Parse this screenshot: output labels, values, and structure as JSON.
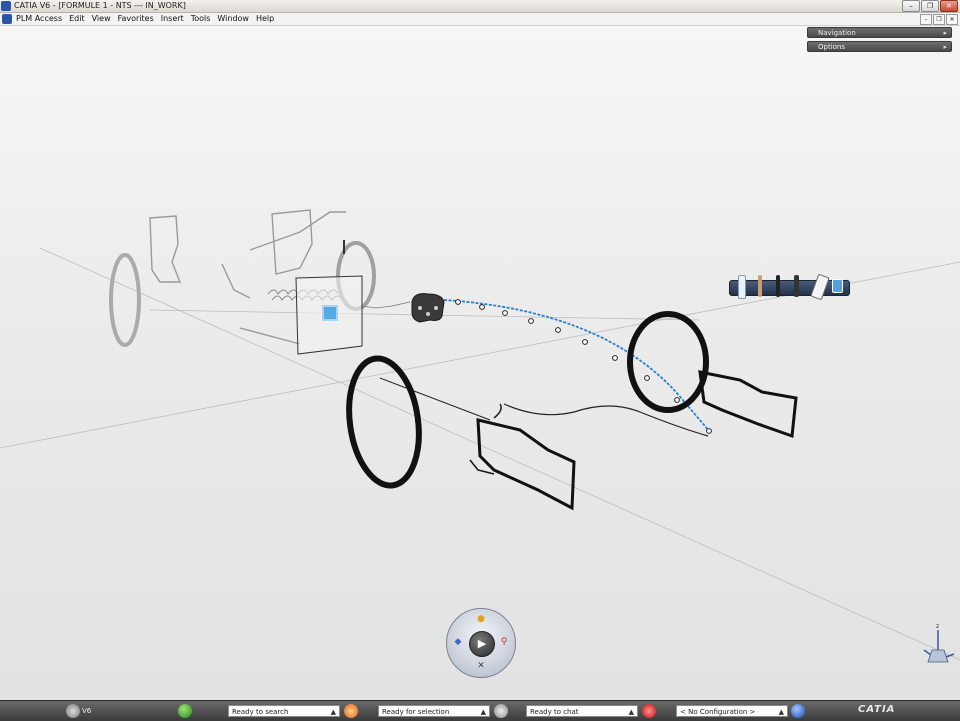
{
  "window": {
    "title": "CATIA V6 - [FORMULE 1 - NTS --- IN_WORK]"
  },
  "menubar": {
    "items": [
      {
        "label": "PLM Access"
      },
      {
        "label": "Edit"
      },
      {
        "label": "View"
      },
      {
        "label": "Favorites"
      },
      {
        "label": "Insert"
      },
      {
        "label": "Tools"
      },
      {
        "label": "Window"
      },
      {
        "label": "Help"
      }
    ]
  },
  "panels": {
    "navigation_label": "Navigation",
    "options_label": "Options"
  },
  "toolbar3d": {
    "tools": [
      "marker-tool-icon",
      "pencil-tool-icon",
      "pen-tool-icon",
      "brush-tool-icon",
      "eraser-tool-icon",
      "image-tool-icon"
    ]
  },
  "compass": {
    "play_glyph": "▶"
  },
  "statusbar": {
    "user": "V6",
    "search_text": "Ready to search",
    "selection_text": "Ready for selection",
    "chat_text": "Ready to chat",
    "config_text": "< No Configuration >",
    "logo_text": "CATIA"
  },
  "colors": {
    "curve": "#2a7fd0",
    "accent": "#2a56a8"
  }
}
